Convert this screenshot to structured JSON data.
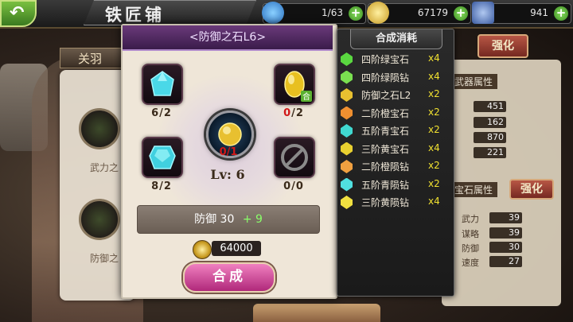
{
  "topbar": {
    "title": "铁匠铺",
    "resources": [
      {
        "icon": "lightning-icon",
        "value": "1/63",
        "color": "#3aa0e0"
      },
      {
        "icon": "coin-icon",
        "value": "67179",
        "color": "#d8a820"
      },
      {
        "icon": "helmet-icon",
        "value": "941",
        "color": "#6080c0"
      }
    ]
  },
  "background": {
    "hero_tab": "关羽",
    "left_labels": [
      "武力之",
      "防御之"
    ],
    "right_panel": {
      "enhance_label": "强化",
      "equip_attr_title": "武器属性",
      "equip_values": [
        "451",
        "162",
        "870",
        "221"
      ],
      "gem_attr_title": "宝石属性",
      "gem_stats": [
        {
          "label": "武力",
          "value": "39"
        },
        {
          "label": "谋略",
          "value": "39"
        },
        {
          "label": "防御",
          "value": "30"
        },
        {
          "label": "速度",
          "value": "27"
        }
      ]
    }
  },
  "dialog": {
    "title": "<防御之石L6>",
    "slots": [
      {
        "name": "top-left",
        "count_have": "6",
        "count_need": "2",
        "gem_color": "#4ad8e8",
        "insufficient": false
      },
      {
        "name": "top-right",
        "count_have": "0",
        "count_need": "2",
        "gem_color": "#e8c020",
        "insufficient": true
      },
      {
        "name": "bottom-left",
        "count_have": "8",
        "count_need": "2",
        "gem_color": "#40d0e0",
        "insufficient": false
      },
      {
        "name": "bottom-right",
        "count_have": "0",
        "count_need": "0",
        "gem_color": "#555555",
        "insufficient": false
      }
    ],
    "center": {
      "count": "0/1",
      "gem_color": "#e8c030"
    },
    "level": "Lv: 6",
    "stat": {
      "label": "防御",
      "value": "30",
      "bonus": "+ 9"
    },
    "cost": "64000",
    "synthesize_label": "合成"
  },
  "materials": {
    "title": "合成消耗",
    "items": [
      {
        "name": "四阶绿宝石",
        "qty": "x4",
        "color": "#5ad840"
      },
      {
        "name": "四阶绿陨钻",
        "qty": "x4",
        "color": "#7ae050"
      },
      {
        "name": "防御之石L2",
        "qty": "x2",
        "color": "#e8c030"
      },
      {
        "name": "二阶橙宝石",
        "qty": "x2",
        "color": "#f09030"
      },
      {
        "name": "五阶青宝石",
        "qty": "x2",
        "color": "#40d8d0"
      },
      {
        "name": "三阶黄宝石",
        "qty": "x4",
        "color": "#e8d030"
      },
      {
        "name": "二阶橙陨钻",
        "qty": "x2",
        "color": "#f0a040"
      },
      {
        "name": "五阶青陨钻",
        "qty": "x2",
        "color": "#50e0e0"
      },
      {
        "name": "三阶黄陨钻",
        "qty": "x4",
        "color": "#f0e040"
      }
    ]
  }
}
